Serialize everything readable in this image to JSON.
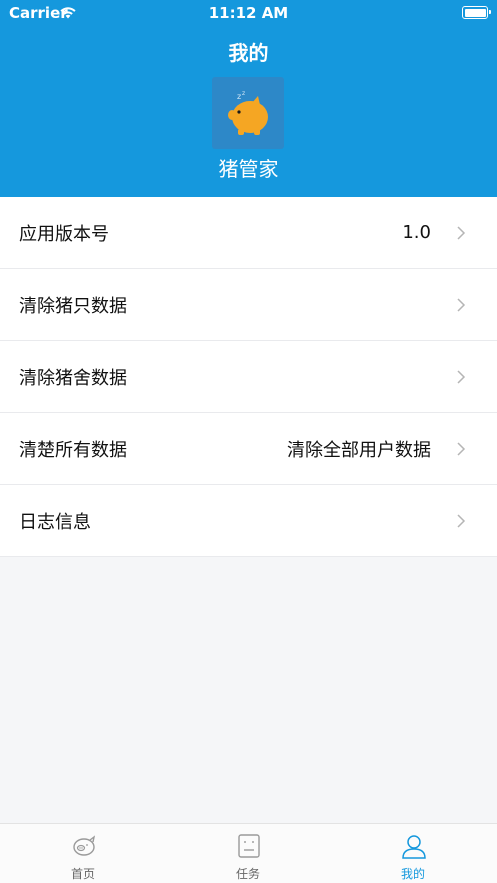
{
  "status_bar": {
    "carrier": "Carrier",
    "time": "11:12 AM"
  },
  "header": {
    "title": "我的",
    "app_name": "猪管家",
    "logo_icon": "pig-icon"
  },
  "menu": [
    {
      "label": "应用版本号",
      "value": "1.0"
    },
    {
      "label": "清除猪只数据",
      "value": ""
    },
    {
      "label": "清除猪舍数据",
      "value": ""
    },
    {
      "label": "清楚所有数据",
      "value": "清除全部用户数据"
    },
    {
      "label": "日志信息",
      "value": ""
    }
  ],
  "tabs": [
    {
      "label": "首页",
      "icon": "pig-face-icon",
      "active": false
    },
    {
      "label": "任务",
      "icon": "task-icon",
      "active": false
    },
    {
      "label": "我的",
      "icon": "user-icon",
      "active": true
    }
  ],
  "colors": {
    "brand": "#1598dd",
    "logo_bg": "#2d88c8",
    "pig": "#f5a623",
    "background": "#f5f6f8"
  }
}
